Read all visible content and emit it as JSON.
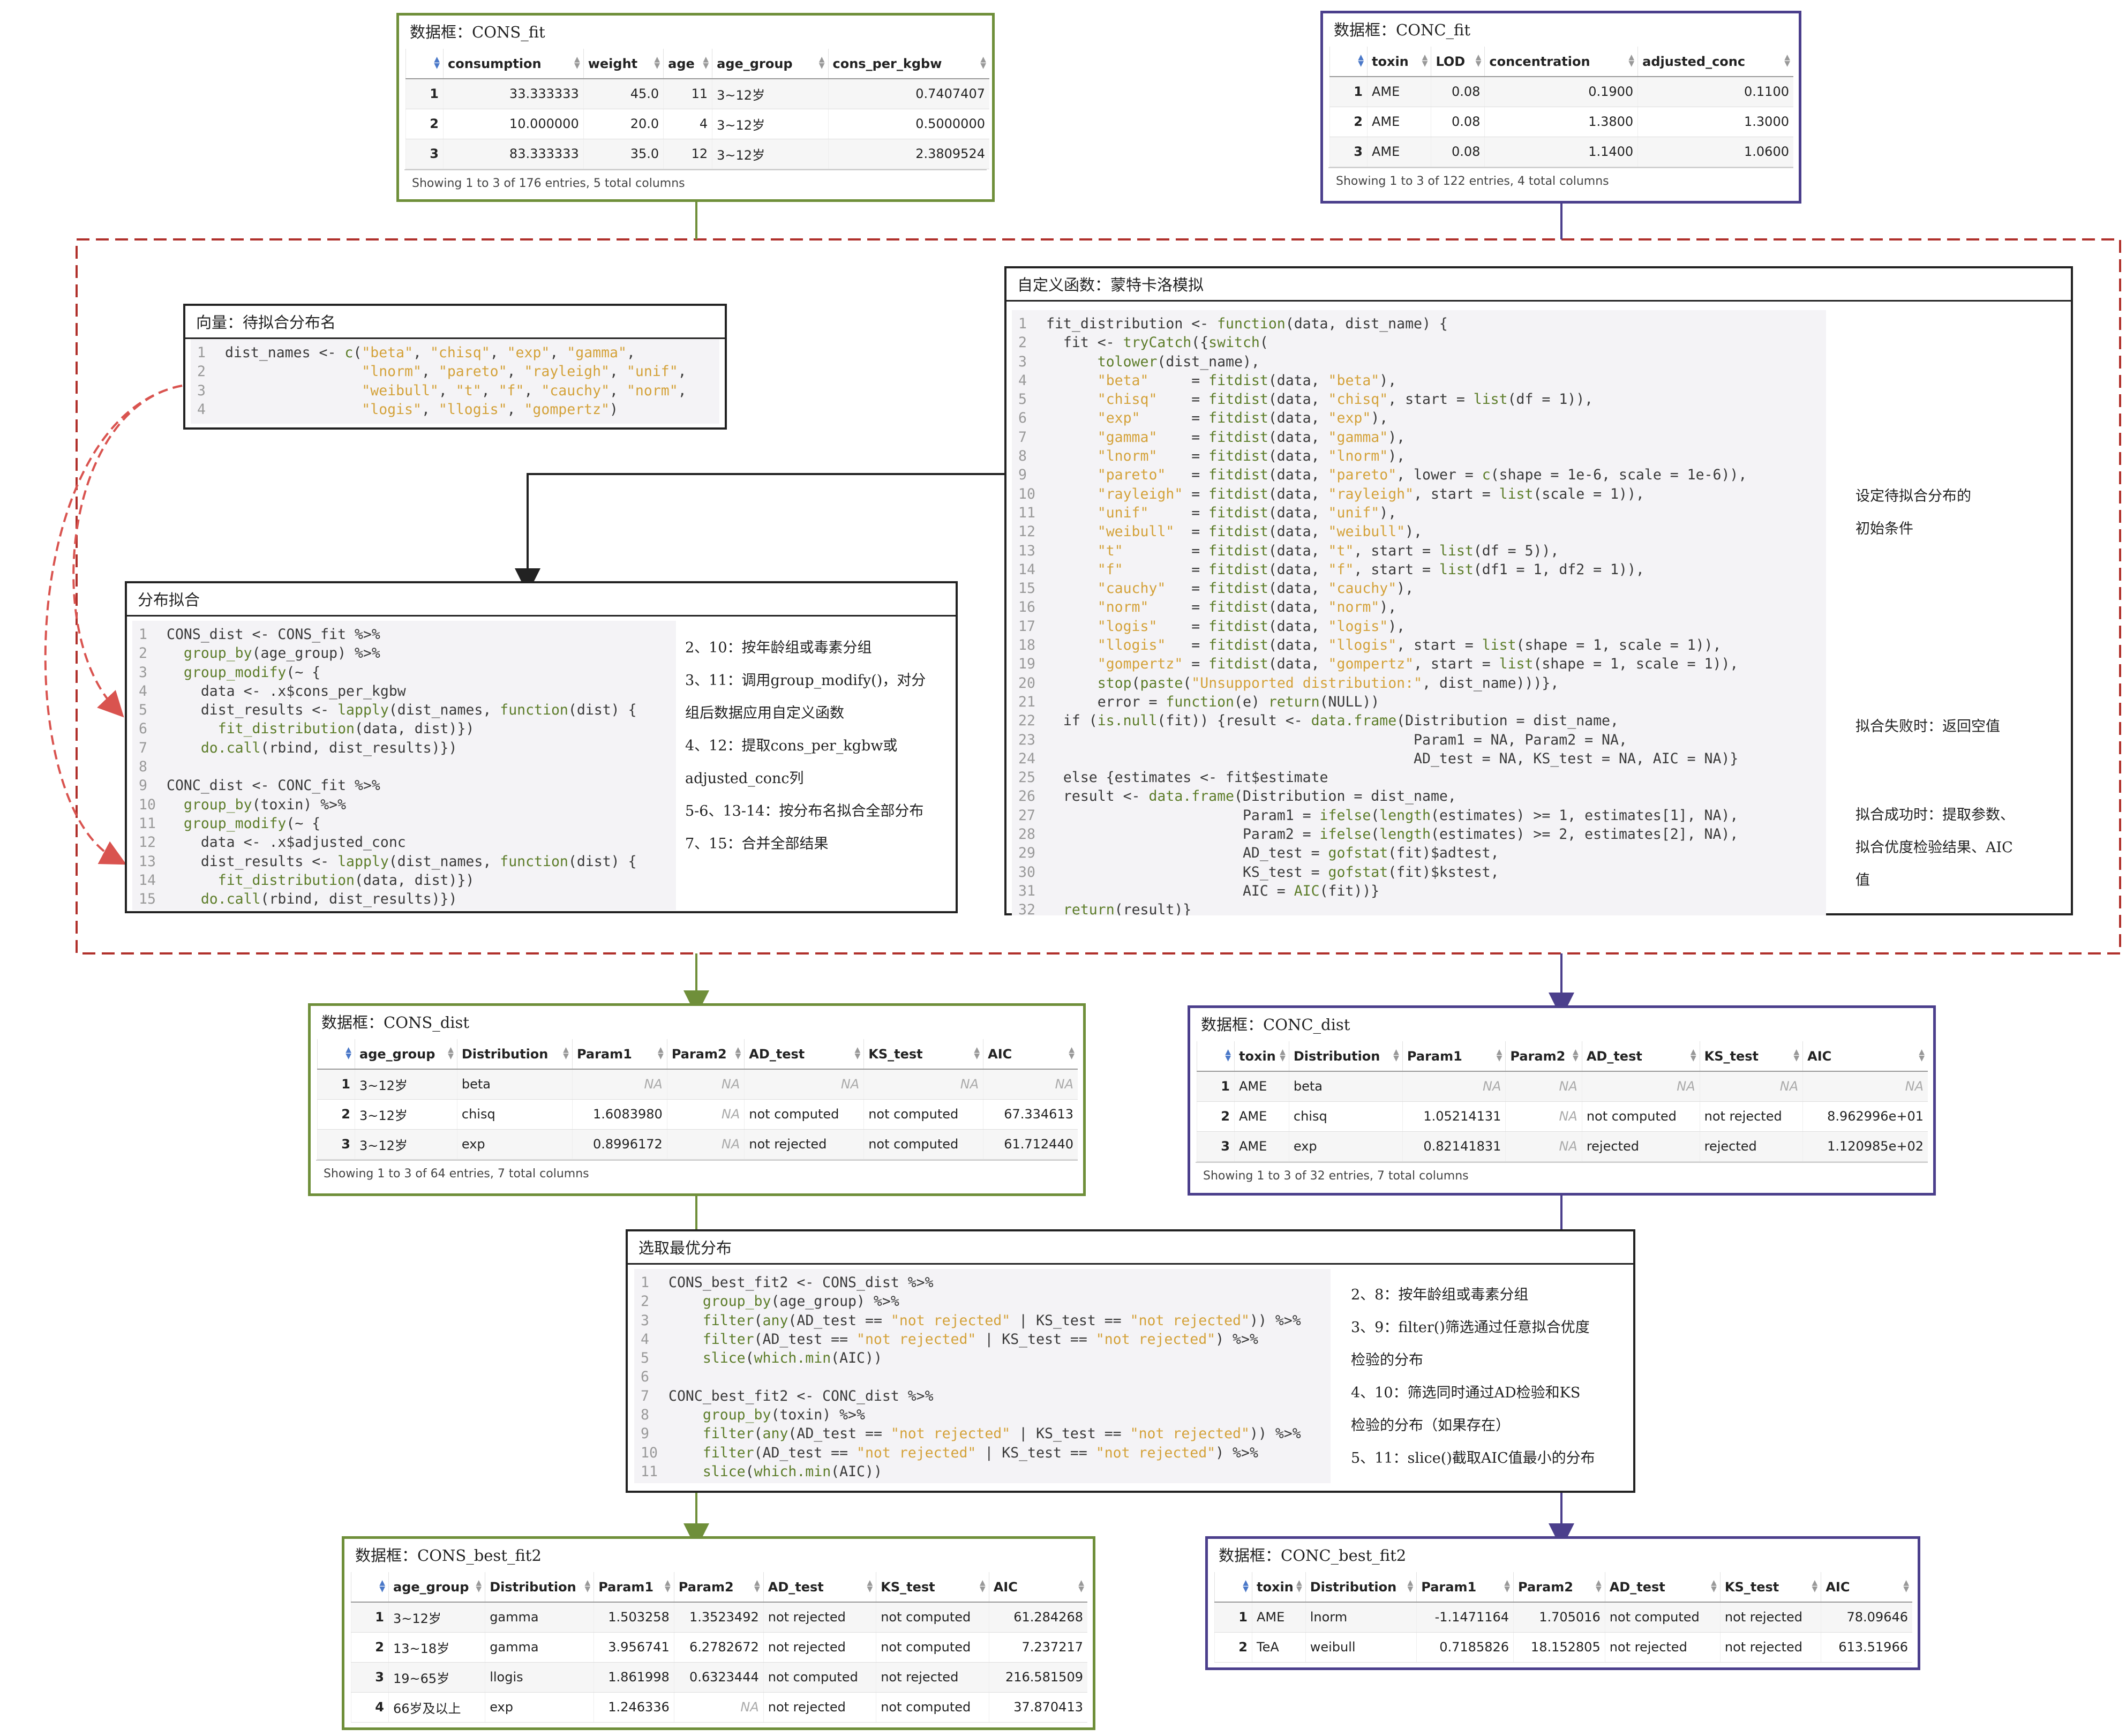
{
  "cons_fit": {
    "title": "数据框：CONS_fit",
    "columns": [
      "",
      "consumption",
      "weight",
      "age",
      "age_group",
      "cons_per_kgbw"
    ],
    "rows": [
      [
        "1",
        "33.333333",
        "45.0",
        "11",
        "3~12岁",
        "0.7407407"
      ],
      [
        "2",
        "10.000000",
        "20.0",
        "4",
        "3~12岁",
        "0.5000000"
      ],
      [
        "3",
        "83.333333",
        "35.0",
        "12",
        "3~12岁",
        "2.3809524"
      ]
    ],
    "footer": "Showing 1 to 3 of 176 entries, 5 total columns"
  },
  "conc_fit": {
    "title": "数据框：CONC_fit",
    "columns": [
      "",
      "toxin",
      "LOD",
      "concentration",
      "adjusted_conc"
    ],
    "rows": [
      [
        "1",
        "AME",
        "0.08",
        "0.1900",
        "0.1100"
      ],
      [
        "2",
        "AME",
        "0.08",
        "1.3800",
        "1.3000"
      ],
      [
        "3",
        "AME",
        "0.08",
        "1.1400",
        "1.0600"
      ]
    ],
    "footer": "Showing 1 to 3 of 122 entries, 4 total columns"
  },
  "dist_names": {
    "title": "向量：待拟合分布名",
    "lines": [
      "dist_names <- c(\"beta\", \"chisq\", \"exp\", \"gamma\",",
      "                \"lnorm\", \"pareto\", \"rayleigh\", \"unif\",",
      "                \"weibull\", \"t\", \"f\", \"cauchy\", \"norm\",",
      "                \"logis\", \"llogis\", \"gompertz\")"
    ]
  },
  "monte_carlo": {
    "title": "自定义函数：蒙特卡洛模拟",
    "lines": [
      "fit_distribution <- function(data, dist_name) {",
      "  fit <- tryCatch({switch(",
      "      tolower(dist_name),",
      "      \"beta\"     = fitdist(data, \"beta\"),",
      "      \"chisq\"    = fitdist(data, \"chisq\", start = list(df = 1)),",
      "      \"exp\"      = fitdist(data, \"exp\"),",
      "      \"gamma\"    = fitdist(data, \"gamma\"),",
      "      \"lnorm\"    = fitdist(data, \"lnorm\"),",
      "      \"pareto\"   = fitdist(data, \"pareto\", lower = c(shape = 1e-6, scale = 1e-6)),",
      "      \"rayleigh\" = fitdist(data, \"rayleigh\", start = list(scale = 1)),",
      "      \"unif\"     = fitdist(data, \"unif\"),",
      "      \"weibull\"  = fitdist(data, \"weibull\"),",
      "      \"t\"        = fitdist(data, \"t\", start = list(df = 5)),",
      "      \"f\"        = fitdist(data, \"f\", start = list(df1 = 1, df2 = 1)),",
      "      \"cauchy\"   = fitdist(data, \"cauchy\"),",
      "      \"norm\"     = fitdist(data, \"norm\"),",
      "      \"logis\"    = fitdist(data, \"logis\"),",
      "      \"llogis\"   = fitdist(data, \"llogis\", start = list(shape = 1, scale = 1)),",
      "      \"gompertz\" = fitdist(data, \"gompertz\", start = list(shape = 1, scale = 1)),",
      "      stop(paste(\"Unsupported distribution:\", dist_name)))},",
      "      error = function(e) return(NULL))",
      "  if (is.null(fit)) {result <- data.frame(Distribution = dist_name,",
      "                                           Param1 = NA, Param2 = NA,",
      "                                           AD_test = NA, KS_test = NA, AIC = NA)}",
      "  else {estimates <- fit$estimate",
      "  result <- data.frame(Distribution = dist_name,",
      "                       Param1 = ifelse(length(estimates) >= 1, estimates[1], NA),",
      "                       Param2 = ifelse(length(estimates) >= 2, estimates[2], NA),",
      "                       AD_test = gofstat(fit)$adtest,",
      "                       KS_test = gofstat(fit)$kstest,",
      "                       AIC = AIC(fit))}",
      "  return(result)}"
    ],
    "annotations": [
      [
        "设定待拟合分布的",
        "初始条件"
      ],
      [
        "拟合失败时：返回空值"
      ],
      [
        "拟合成功时：提取参数、",
        "拟合优度检验结果、AIC",
        "值"
      ]
    ]
  },
  "dist_fit": {
    "title": "分布拟合",
    "lines": [
      "CONS_dist <- CONS_fit %>%",
      "  group_by(age_group) %>%",
      "  group_modify(~ {",
      "    data <- .x$cons_per_kgbw",
      "    dist_results <- lapply(dist_names, function(dist) {",
      "      fit_distribution(data, dist)})",
      "    do.call(rbind, dist_results)})",
      "",
      "CONC_dist <- CONC_fit %>%",
      "  group_by(toxin) %>%",
      "  group_modify(~ {",
      "    data <- .x$adjusted_conc",
      "    dist_results <- lapply(dist_names, function(dist) {",
      "      fit_distribution(data, dist)})",
      "    do.call(rbind, dist_results)})"
    ],
    "notes": [
      "2、10：按年龄组或毒素分组",
      "3、11：调用group_modify()，对分",
      "组后数据应用自定义函数",
      "4、12：提取cons_per_kgbw或",
      "adjusted_conc列",
      "5-6、13-14：按分布名拟合全部分布",
      "7、15：合并全部结果"
    ]
  },
  "cons_dist": {
    "title": "数据框：CONS_dist",
    "columns": [
      "",
      "age_group",
      "Distribution",
      "Param1",
      "Param2",
      "AD_test",
      "KS_test",
      "AIC"
    ],
    "rows": [
      [
        "1",
        "3~12岁",
        "beta",
        "NA",
        "NA",
        "NA",
        "NA",
        "NA"
      ],
      [
        "2",
        "3~12岁",
        "chisq",
        "1.6083980",
        "NA",
        "not computed",
        "not computed",
        "67.334613"
      ],
      [
        "3",
        "3~12岁",
        "exp",
        "0.8996172",
        "NA",
        "not rejected",
        "not computed",
        "61.712440"
      ]
    ],
    "footer": "Showing 1 to 3 of 64 entries, 7 total columns"
  },
  "conc_dist": {
    "title": "数据框：CONC_dist",
    "columns": [
      "",
      "toxin",
      "Distribution",
      "Param1",
      "Param2",
      "AD_test",
      "KS_test",
      "AIC"
    ],
    "rows": [
      [
        "1",
        "AME",
        "beta",
        "NA",
        "NA",
        "NA",
        "NA",
        "NA"
      ],
      [
        "2",
        "AME",
        "chisq",
        "1.05214131",
        "NA",
        "not computed",
        "not rejected",
        "8.962996e+01"
      ],
      [
        "3",
        "AME",
        "exp",
        "0.82141831",
        "NA",
        "rejected",
        "rejected",
        "1.120985e+02"
      ]
    ],
    "footer": "Showing 1 to 3 of 32 entries, 7 total columns"
  },
  "best_fit": {
    "title": "选取最优分布",
    "lines": [
      "CONS_best_fit2 <- CONS_dist %>%",
      "    group_by(age_group) %>%",
      "    filter(any(AD_test == \"not rejected\" | KS_test == \"not rejected\")) %>%",
      "    filter(AD_test == \"not rejected\" | KS_test == \"not rejected\") %>%",
      "    slice(which.min(AIC))",
      "",
      "CONC_best_fit2 <- CONC_dist %>%",
      "    group_by(toxin) %>%",
      "    filter(any(AD_test == \"not rejected\" | KS_test == \"not rejected\")) %>%",
      "    filter(AD_test == \"not rejected\" | KS_test == \"not rejected\") %>%",
      "    slice(which.min(AIC))"
    ],
    "notes": [
      "2、8：按年龄组或毒素分组",
      "3、9：filter()筛选通过任意拟合优度",
      "检验的分布",
      "4、10：筛选同时通过AD检验和KS",
      "检验的分布（如果存在）",
      "5、11：slice()截取AIC值最小的分布"
    ]
  },
  "cons_best": {
    "title": "数据框：CONS_best_fit2",
    "columns": [
      "",
      "age_group",
      "Distribution",
      "Param1",
      "Param2",
      "AD_test",
      "KS_test",
      "AIC"
    ],
    "rows": [
      [
        "1",
        "3~12岁",
        "gamma",
        "1.503258",
        "1.3523492",
        "not rejected",
        "not computed",
        "61.284268"
      ],
      [
        "2",
        "13~18岁",
        "gamma",
        "3.956741",
        "6.2782672",
        "not rejected",
        "not computed",
        "7.237217"
      ],
      [
        "3",
        "19~65岁",
        "llogis",
        "1.861998",
        "0.6323444",
        "not computed",
        "not rejected",
        "216.581509"
      ],
      [
        "4",
        "66岁及以上",
        "exp",
        "1.246336",
        "NA",
        "not rejected",
        "not computed",
        "37.870413"
      ]
    ]
  },
  "conc_best": {
    "title": "数据框：CONC_best_fit2",
    "columns": [
      "",
      "toxin",
      "Distribution",
      "Param1",
      "Param2",
      "AD_test",
      "KS_test",
      "AIC"
    ],
    "rows": [
      [
        "1",
        "AME",
        "lnorm",
        "-1.1471164",
        "1.705016",
        "not computed",
        "not rejected",
        "78.09646"
      ],
      [
        "2",
        "TeA",
        "weibull",
        "0.7185826",
        "18.152805",
        "not rejected",
        "not rejected",
        "613.51966"
      ]
    ]
  },
  "colors": {
    "green": "#6f8f3a",
    "purple": "#4b3f8c",
    "red_dashed": "#c0392b",
    "code_bg": "#f4f3f6",
    "string": "#d4a23a"
  }
}
